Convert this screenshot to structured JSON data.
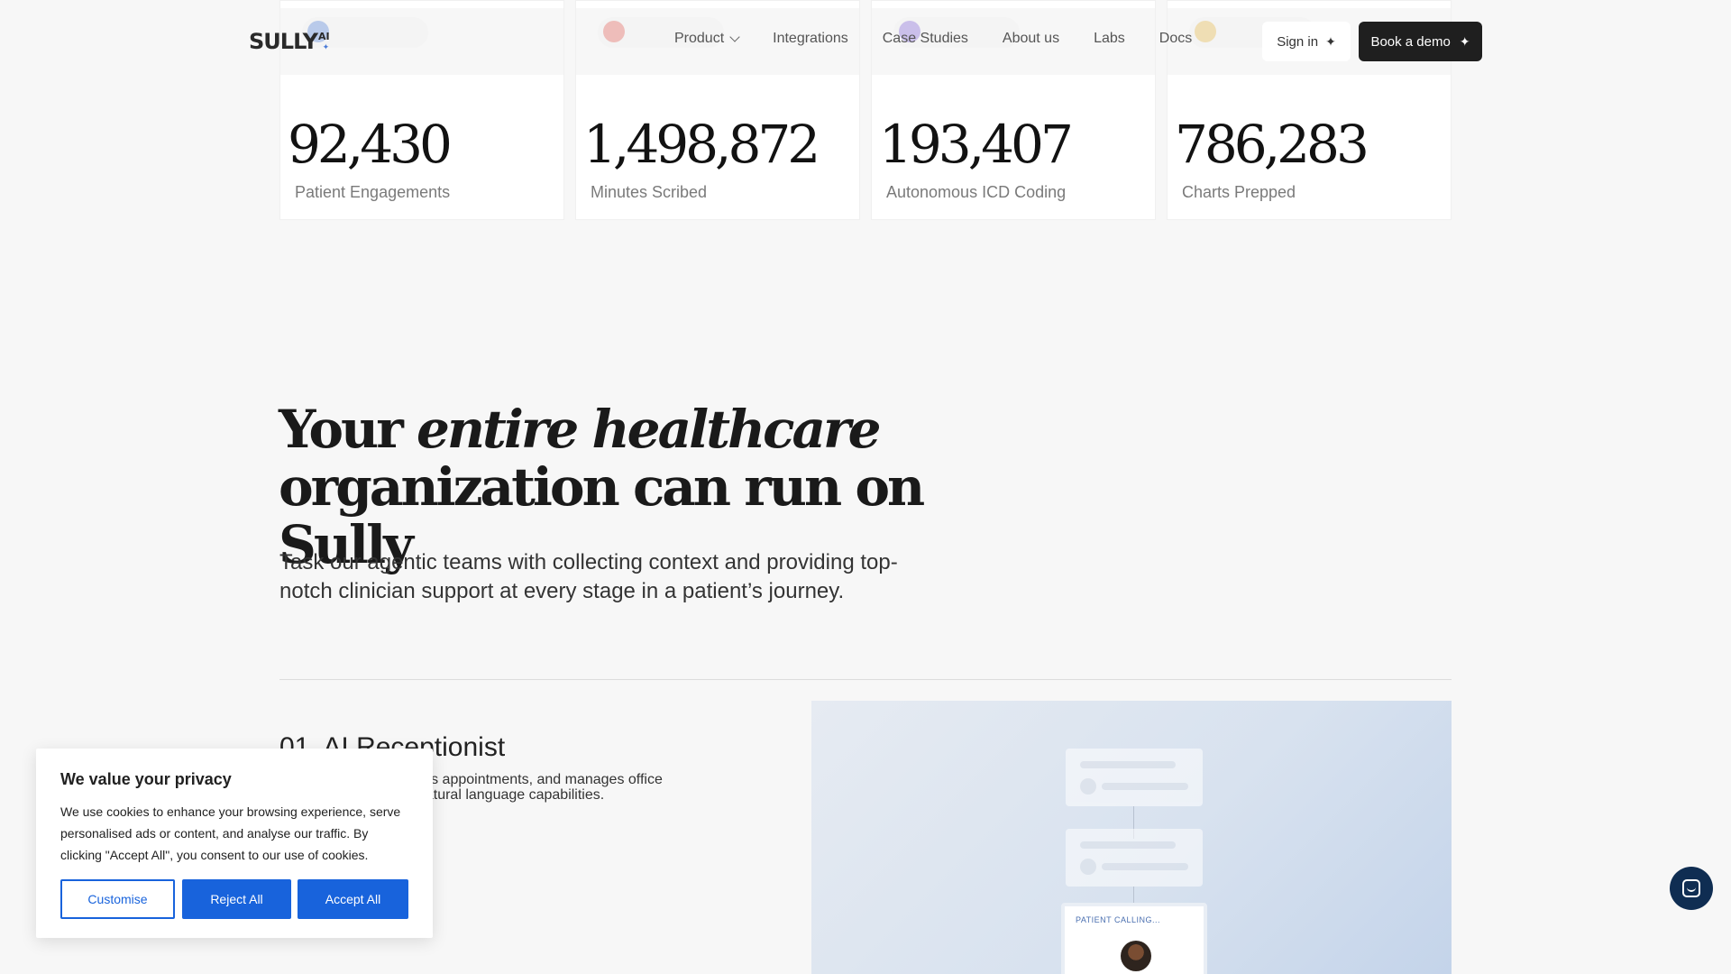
{
  "nav": {
    "logo": "SULLY",
    "logo_suffix": "AI",
    "links": [
      "Product",
      "Integrations",
      "Case Studies",
      "About us",
      "Labs",
      "Docs"
    ],
    "sign_in": "Sign in",
    "book_demo": "Book a demo"
  },
  "stats": [
    {
      "value": "92,430",
      "label": "Patient Engagements",
      "accent": "#4a7bd8"
    },
    {
      "value": "1,498,872",
      "label": "Minutes Scribed",
      "accent": "#e2574c"
    },
    {
      "value": "193,407",
      "label": "Autonomous ICD Coding",
      "accent": "#7b5cd6"
    },
    {
      "value": "786,283",
      "label": "Charts Prepped",
      "accent": "#e6b43c"
    }
  ],
  "hero": {
    "title_pre": "Your ",
    "title_em": "entire healthcare",
    "title_post": "organization can run on Sully",
    "subtitle": "Task our agentic teams with collecting context and providing top-notch clinician support at every stage in a patient’s journey."
  },
  "feature": {
    "title": "01. AI Receptionist",
    "description": "Handles calls, schedules appointments, and manages office communications with natural language capabilities.",
    "call_label": "PATIENT CALLING..."
  },
  "cookie": {
    "title": "We value your privacy",
    "text": "We use cookies to enhance your browsing experience, serve personalised ads or content, and analyse our traffic. By clicking \"Accept All\", you consent to our use of cookies.",
    "customise": "Customise",
    "reject": "Reject All",
    "accept": "Accept All"
  },
  "colors": {
    "primary_button": "#1863dc",
    "chat_launcher": "#0f2d52",
    "demo_button": "#1f1f1f"
  },
  "icons": {
    "sparkle": "✦",
    "chat": "chat-icon"
  }
}
